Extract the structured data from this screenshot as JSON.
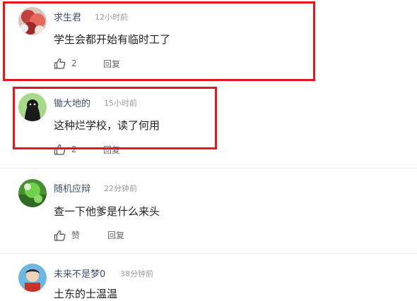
{
  "comments": [
    {
      "username": "求生君",
      "timestamp": "12小时前",
      "content": "学生会都开始有临时工了",
      "like_count": "2",
      "reply_label": "回复"
    },
    {
      "username": "锄大地的",
      "timestamp": "15小时前",
      "content": "这种烂学校，读了何用",
      "like_count": "2",
      "reply_label": "回复"
    },
    {
      "username": "随机应辩",
      "timestamp": "22分钟前",
      "content": "查一下他爹是什么来头",
      "like_count": "赞",
      "reply_label": "回复"
    },
    {
      "username": "未来不是梦0",
      "timestamp": "38分钟前",
      "content": "土东的士温温",
      "like_count": "",
      "reply_label": ""
    }
  ],
  "colors": {
    "highlight": "#e5171c",
    "username": "#404f6b",
    "timestamp": "#9a9a9a",
    "divider": "#eeeeee"
  },
  "icons": {
    "like": "thumbs-up-icon"
  }
}
